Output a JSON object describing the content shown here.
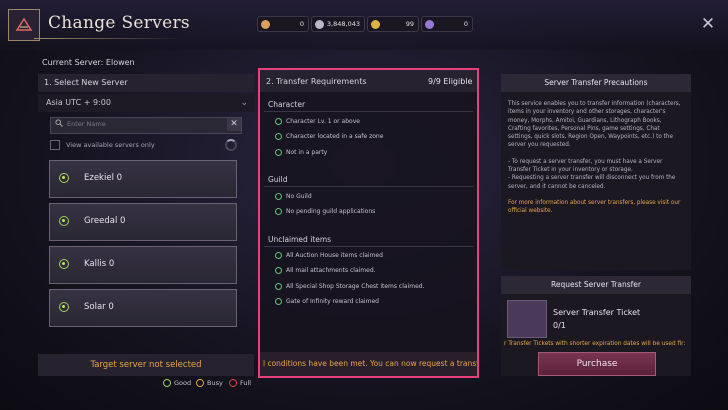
{
  "header": {
    "title": "Change Servers",
    "currencies": [
      {
        "icon": "feather-icon",
        "value": "0",
        "color": "#d9a25a"
      },
      {
        "icon": "silver-coin-icon",
        "value": "3,848,043",
        "color": "#b8b8c8"
      },
      {
        "icon": "gold-coin-icon",
        "value": "99",
        "color": "#e0b24a"
      },
      {
        "icon": "crystal-icon",
        "value": "0",
        "color": "#9a78d8"
      }
    ],
    "close_label": "✕"
  },
  "current_server": "Current Server: Elowen",
  "left_panel": {
    "title": "1. Select New Server",
    "region": "Asia UTC + 9:00",
    "search_placeholder": "Enter Name",
    "available_only_label": "View available servers only",
    "servers": [
      {
        "name": "Ezekiel",
        "count": "0"
      },
      {
        "name": "Greedal",
        "count": "0"
      },
      {
        "name": "Kallis",
        "count": "0"
      },
      {
        "name": "Solar",
        "count": "0"
      }
    ],
    "target_status": "Target server not selected"
  },
  "legend": [
    {
      "label": "Good",
      "color": "#9fcf5a"
    },
    {
      "label": "Busy",
      "color": "#e0a040"
    },
    {
      "label": "Full",
      "color": "#d84040"
    }
  ],
  "middle_panel": {
    "title": "2. Transfer Requirements",
    "eligible": "9/9 Eligible",
    "sections": [
      {
        "title": "Character",
        "items": [
          "Character Lv. 1 or above",
          "Character located in a safe zone",
          "Not in a party"
        ]
      },
      {
        "title": "Guild",
        "items": [
          "No Guild",
          "No pending guild applications"
        ]
      },
      {
        "title": "Unclaimed items",
        "items": [
          "All Auction House items claimed",
          "All mail attachments claimed.",
          "All Special Shop Storage Chest items claimed.",
          "Gate of Infinity reward claimed"
        ]
      }
    ],
    "footer": "l conditions have been met. You can now request a transfe"
  },
  "right_panel": {
    "precautions_title": "Server Transfer Precautions",
    "precautions": [
      "This service enables you to transfer information (characters, items in your inventory and other storages, character's money, Morphs, Amitoi, Guardians, Lithograph Books, Crafting favorites, Personal Pins, game settings, Chat settings, quick slots, Region Open, Waypoints, etc.) to the server you requested.",
      "- To request a server transfer, you must have a Server Transfer Ticket in your inventory or storage.\n- Requesting a server transfer will disconnect you from the server, and it cannot be canceled."
    ],
    "more_info": "For more information about server transfers, please visit our official website.",
    "request_title": "Request Server Transfer",
    "ticket_name": "Server Transfer Ticket",
    "ticket_qty": "0/1",
    "ticket_note": "r Transfer Tickets with shorter expiration dates will be used fir:",
    "purchase_label": "Purchase"
  }
}
